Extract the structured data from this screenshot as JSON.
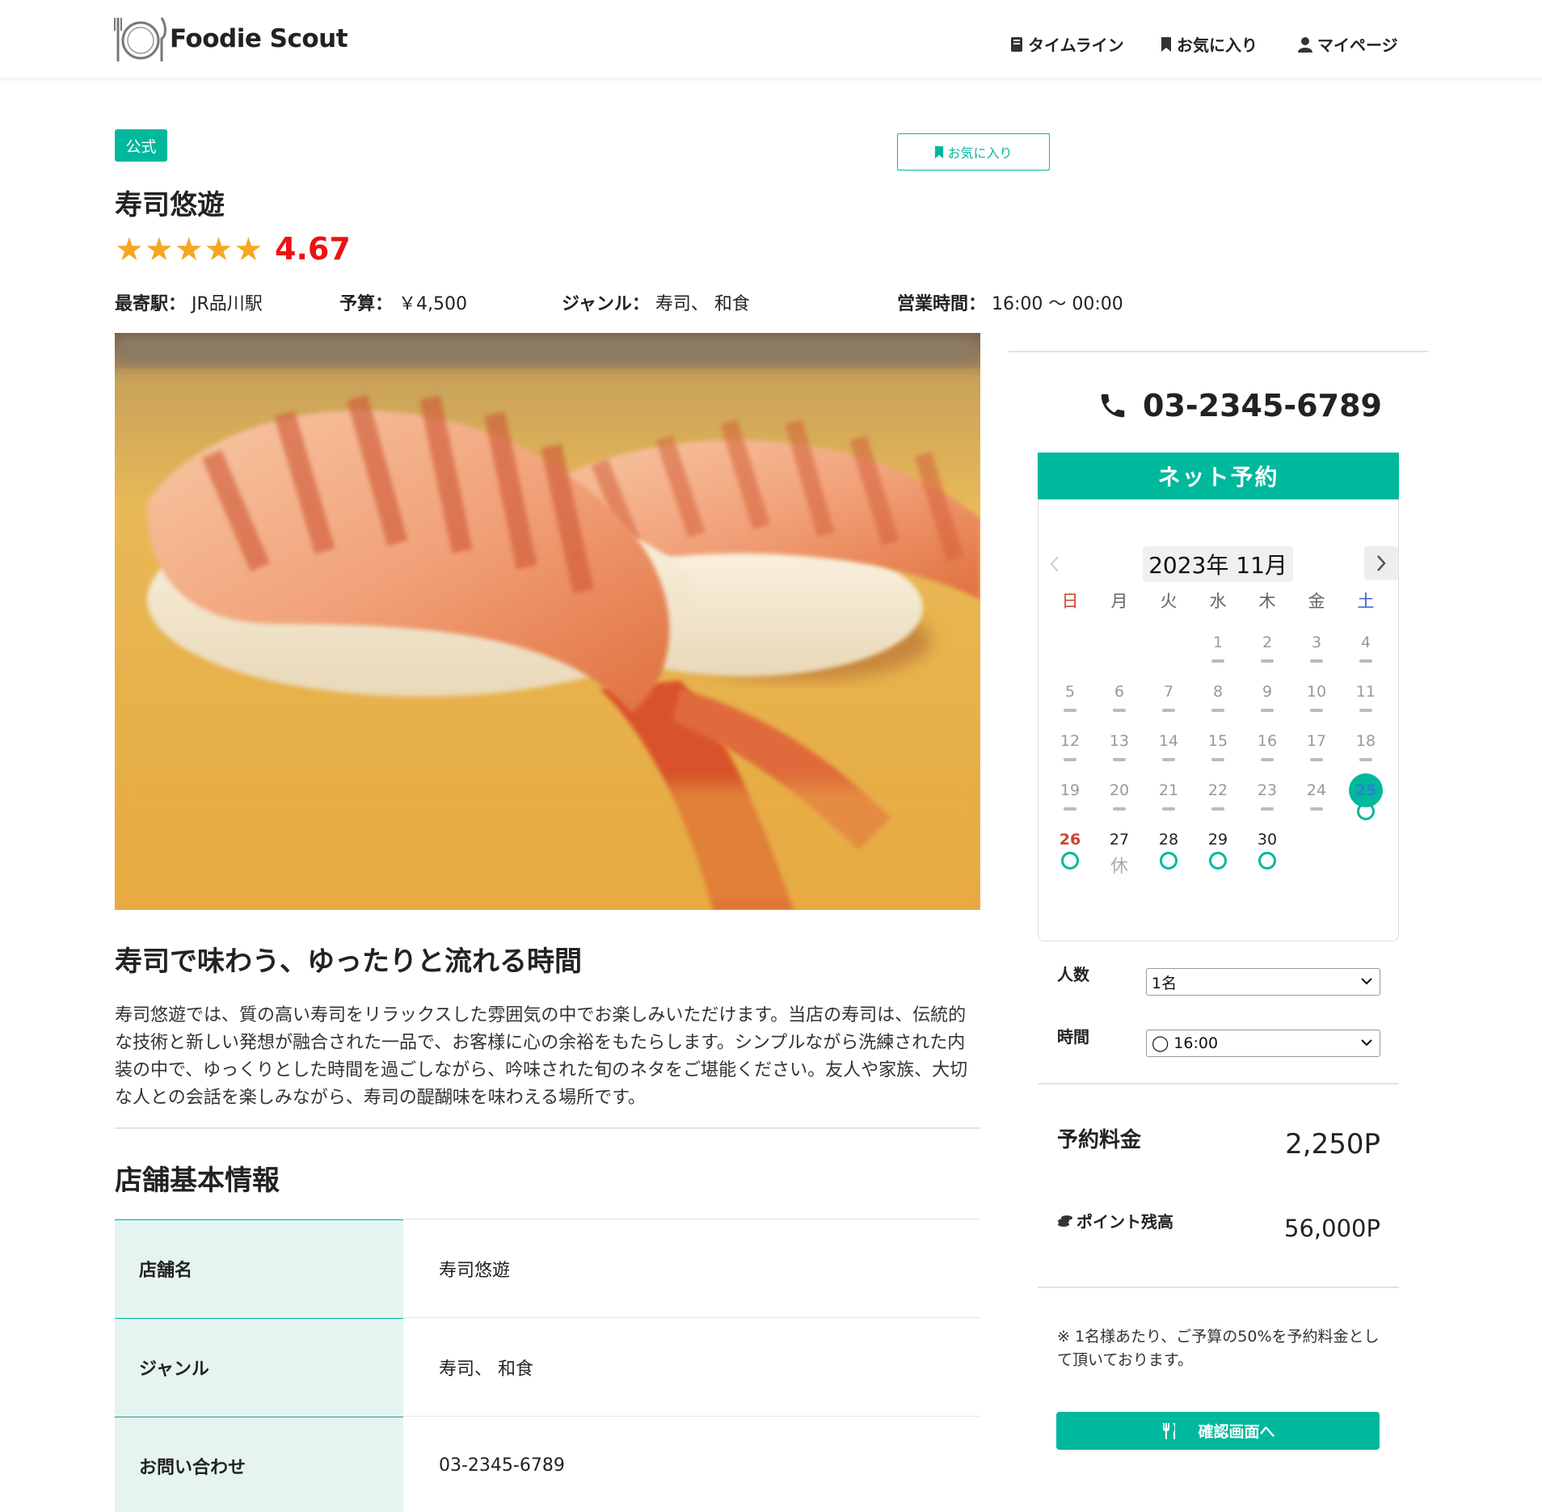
{
  "header": {
    "logo_text": "Foodie Scout",
    "nav": [
      {
        "label": "タイムライン",
        "icon": "book-icon"
      },
      {
        "label": "お気に入り",
        "icon": "bookmark-icon"
      },
      {
        "label": "マイページ",
        "icon": "user-icon"
      }
    ]
  },
  "shop": {
    "badge": "公式",
    "favorite_label": "お気に入り",
    "name": "寿司悠遊",
    "stars": "★★★★★",
    "rating": "4.67",
    "station_label": "最寄駅：",
    "station": "JR品川駅",
    "budget_label": "予算：",
    "budget": "￥4,500",
    "genre_label": "ジャンル：",
    "genre": "寿司、 和食",
    "hours_label": "営業時間：",
    "hours": "16:00 〜 00:00",
    "catch": "寿司で味わう、ゆったりと流れる時間",
    "description": "寿司悠遊では、質の高い寿司をリラックスした雰囲気の中でお楽しみいただけます。当店の寿司は、伝統的な技術と新しい発想が融合された一品で、お客様に心の余裕をもたらします。シンプルながら洗練された内装の中で、ゆっくりとした時間を過ごしながら、吟味された旬のネタをご堪能ください。友人や家族、大切な人との会話を楽しみながら、寿司の醍醐味を味わえる場所です。"
  },
  "basic_info": {
    "title": "店舗基本情報",
    "rows": [
      {
        "label": "店舗名",
        "value": "寿司悠遊"
      },
      {
        "label": "ジャンル",
        "value": "寿司、 和食"
      },
      {
        "label": "お問い合わせ",
        "value": "03-2345-6789"
      }
    ]
  },
  "reservation": {
    "phone": "03-2345-6789",
    "net_label": "ネット予約",
    "calendar": {
      "month": "2023年 11月",
      "weekdays": [
        "日",
        "月",
        "火",
        "水",
        "木",
        "金",
        "土"
      ],
      "selected_day": 25
    },
    "people_label": "人数",
    "people_value": "1名",
    "time_label": "時間",
    "time_value": "◯ 16:00",
    "fee_label": "予約料金",
    "fee_value": "2,250P",
    "points_label": "ポイント残高",
    "points_value": "56,000P",
    "note": "※ 1名様あたり、ご予算の50%を予約料金として頂いております。",
    "confirm_label": "確認画面へ"
  },
  "colors": {
    "accent": "#00b89c",
    "rating": "#ee1111",
    "star": "#f5a623"
  }
}
